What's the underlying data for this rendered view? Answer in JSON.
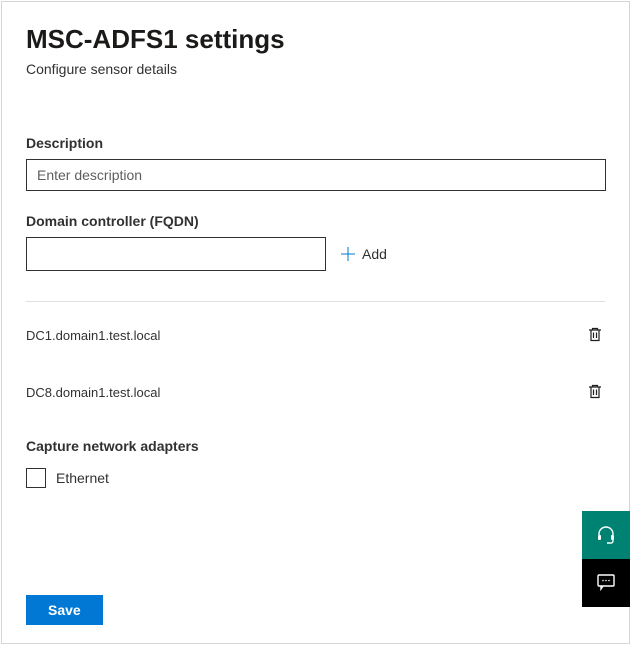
{
  "header": {
    "title": "MSC-ADFS1 settings",
    "subtitle": "Configure sensor details"
  },
  "description": {
    "label": "Description",
    "placeholder": "Enter description",
    "value": ""
  },
  "domainController": {
    "label": "Domain controller (FQDN)",
    "value": "",
    "addLabel": "Add",
    "items": [
      {
        "name": "DC1.domain1.test.local"
      },
      {
        "name": "DC8.domain1.test.local"
      }
    ]
  },
  "adapters": {
    "label": "Capture network adapters",
    "options": [
      {
        "label": "Ethernet",
        "checked": false
      }
    ]
  },
  "actions": {
    "save": "Save"
  }
}
